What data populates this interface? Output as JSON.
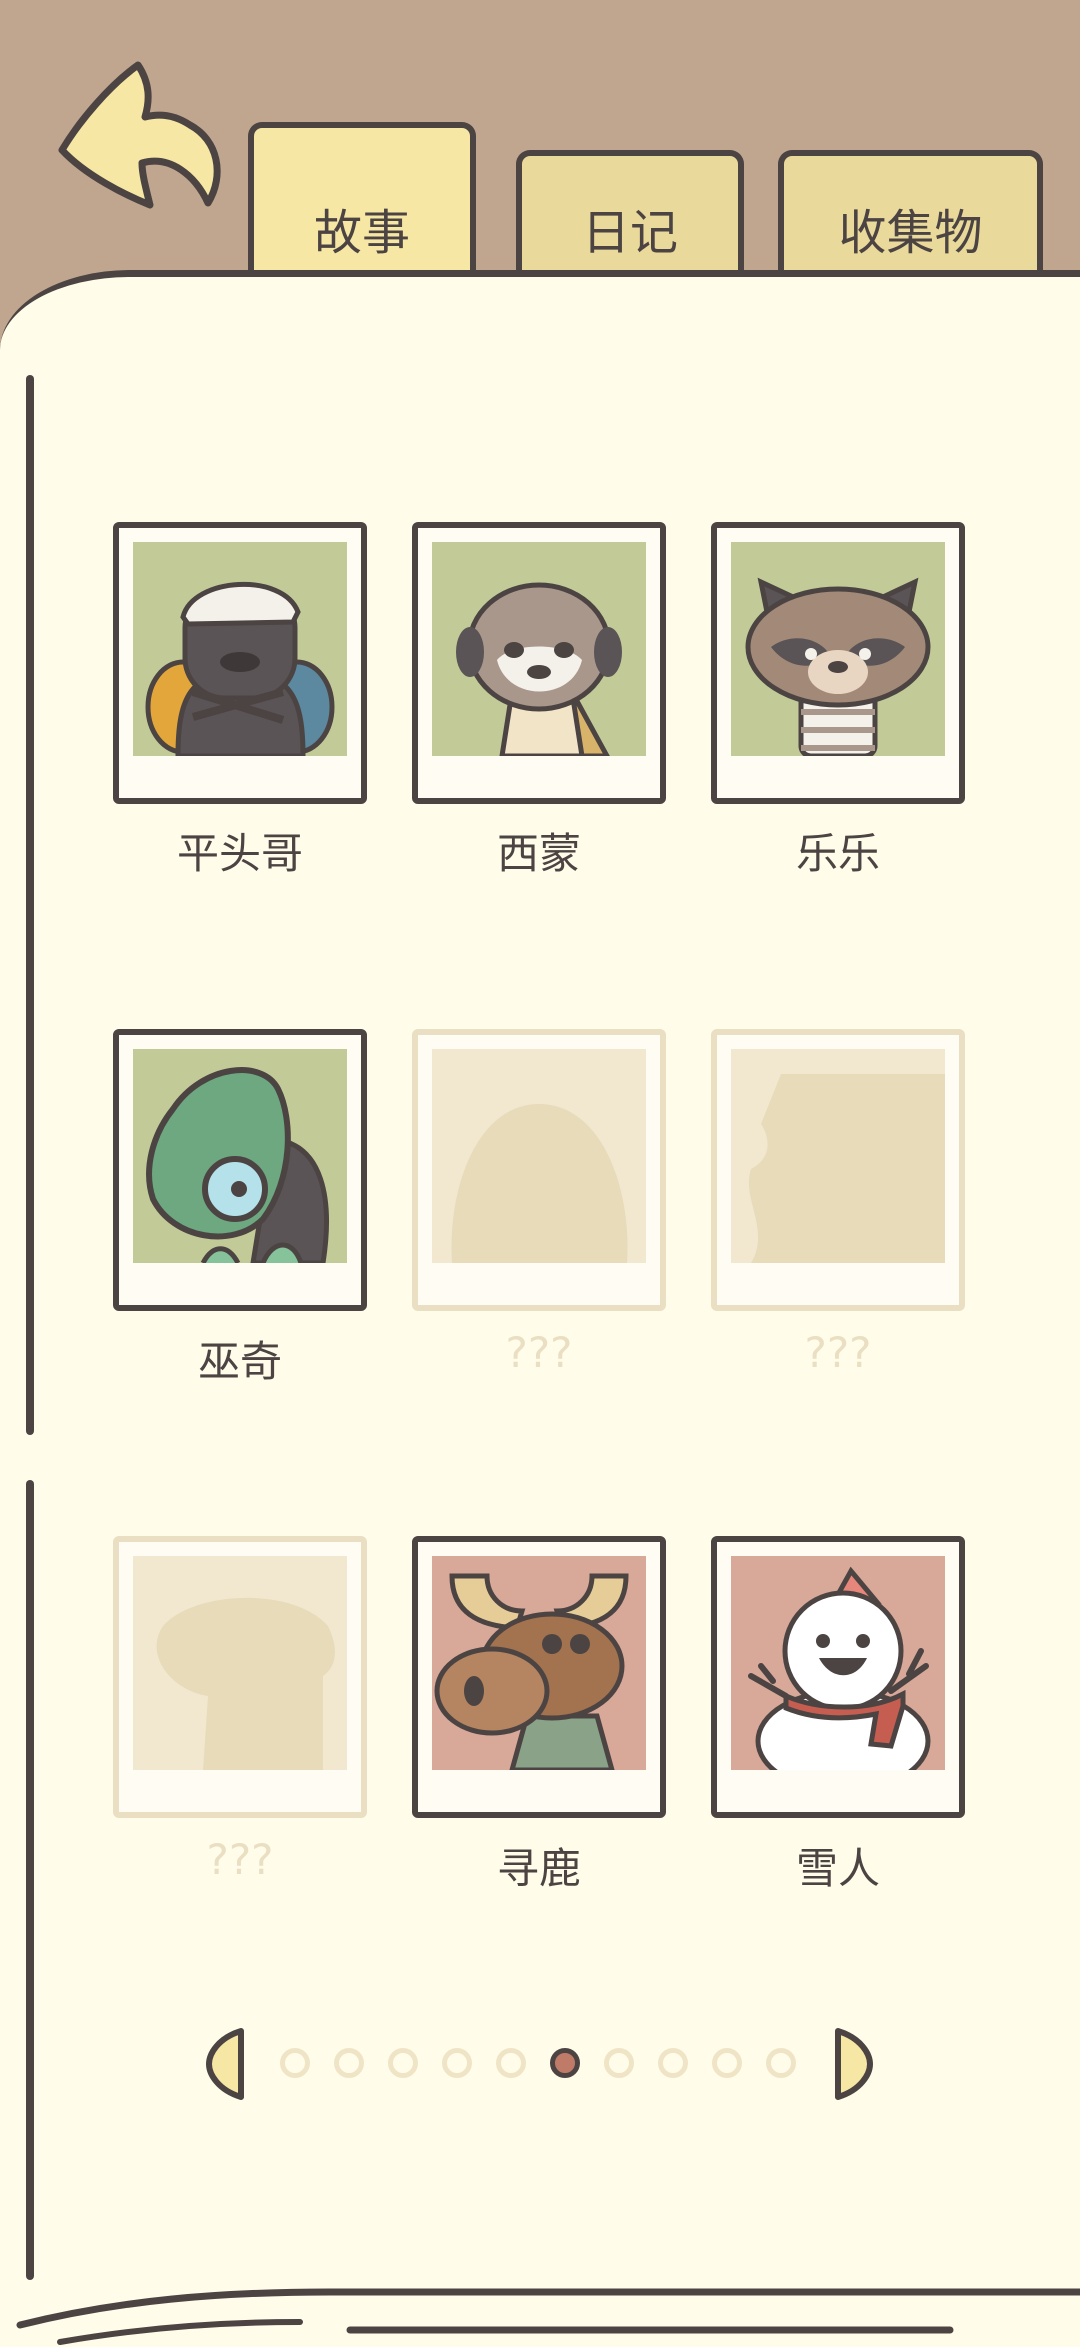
{
  "tabs": [
    {
      "label": "故事",
      "active": true
    },
    {
      "label": "日记",
      "active": false
    },
    {
      "label": "收集物",
      "active": false
    }
  ],
  "characters": [
    {
      "name": "平头哥",
      "unlocked": true,
      "icon": "honey-badger"
    },
    {
      "name": "西蒙",
      "unlocked": true,
      "icon": "meerkat"
    },
    {
      "name": "乐乐",
      "unlocked": true,
      "icon": "raccoon-dog"
    },
    {
      "name": "巫奇",
      "unlocked": true,
      "icon": "chameleon"
    },
    {
      "name": "???",
      "unlocked": false,
      "icon": "silhouette"
    },
    {
      "name": "???",
      "unlocked": false,
      "icon": "silhouette"
    },
    {
      "name": "???",
      "unlocked": false,
      "icon": "silhouette"
    },
    {
      "name": "寻鹿",
      "unlocked": true,
      "icon": "moose"
    },
    {
      "name": "雪人",
      "unlocked": true,
      "icon": "snowman"
    }
  ],
  "pagination": {
    "current_page": 6,
    "total_pages": 10
  },
  "colors": {
    "background": "#c1a68f",
    "page": "#fffce9",
    "outline": "#4c4443",
    "tab": "#e9d99a",
    "active_dot": "#c07b68",
    "locked": "#eadfc2"
  }
}
